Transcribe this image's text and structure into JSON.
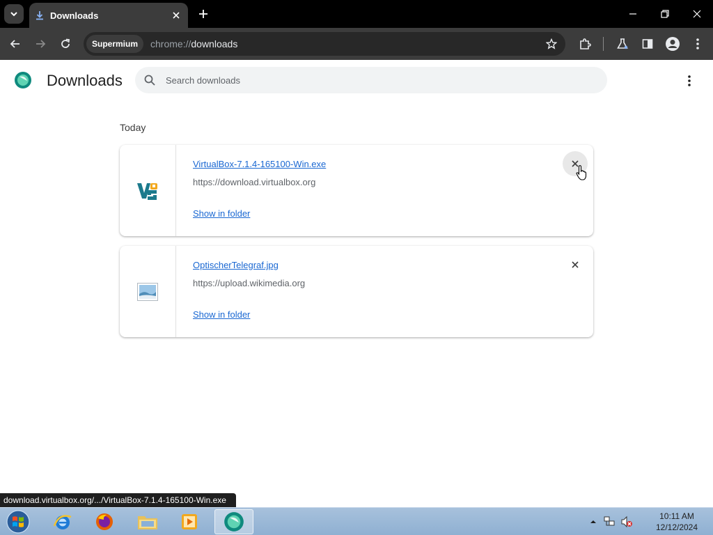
{
  "browser": {
    "tab": {
      "title": "Downloads"
    },
    "omnibox": {
      "chip": "Supermium",
      "url_scheme": "chrome://",
      "url_host": "downloads"
    }
  },
  "page": {
    "title": "Downloads",
    "search": {
      "placeholder": "Search downloads",
      "value": ""
    },
    "section_label": "Today",
    "downloads": [
      {
        "file_name": "VirtualBox-7.1.4-165100-Win.exe",
        "url": "https://download.virtualbox.org",
        "action": "Show in folder",
        "icon": "virtualbox-icon"
      },
      {
        "file_name": "OptischerTelegraf.jpg",
        "url": "https://upload.wikimedia.org",
        "action": "Show in folder",
        "icon": "image-file-icon"
      }
    ]
  },
  "status_bubble": "download.virtualbox.org/.../VirtualBox-7.1.4-165100-Win.exe",
  "taskbar": {
    "apps": [
      "internet-explorer-icon",
      "firefox-icon",
      "file-explorer-icon",
      "media-player-icon",
      "supermium-icon"
    ],
    "clock": {
      "time": "10:11 AM",
      "date": "12/12/2024"
    }
  },
  "colors": {
    "titlebar": "#000000",
    "toolbar": "#3c3c3c",
    "link": "#1967d2",
    "taskbar": "#a7c1dc"
  }
}
